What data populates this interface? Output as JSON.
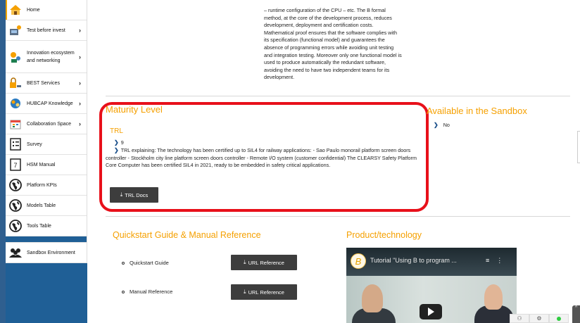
{
  "sidebar": {
    "items": [
      {
        "label": "Home",
        "icon": "house-icon",
        "chevron": false
      },
      {
        "label": "Test before invest",
        "icon": "equipment-icon",
        "chevron": true
      },
      {
        "label": "Innovation ecosystem and networking",
        "icon": "network-icon",
        "chevron": true
      },
      {
        "label": "BEST Services",
        "icon": "services-icon",
        "chevron": true
      },
      {
        "label": "HUBCAP Knowledge",
        "icon": "knowledge-icon",
        "chevron": true
      },
      {
        "label": "Collaboration Space",
        "icon": "calendar-icon",
        "chevron": true
      },
      {
        "label": "Survey",
        "icon": "survey-icon",
        "chevron": false
      },
      {
        "label": "HSM Manual",
        "icon": "manual-icon",
        "chevron": false
      },
      {
        "label": "Platform KPIs",
        "icon": "globe-icon",
        "chevron": false
      },
      {
        "label": "Models Table",
        "icon": "globe-icon",
        "chevron": false
      },
      {
        "label": "Tools Table",
        "icon": "globe-icon",
        "chevron": false
      }
    ],
    "environment": {
      "label": "Sandbox Environment",
      "icon": "group-icon"
    },
    "chevron_glyph": "›"
  },
  "description": {
    "lines": [
      "– runtime configuration of the CPU – etc. The B formal",
      "method, at the core of the development process, reduces",
      "development, deployment and certification costs.",
      "Mathematical proof ensures that the software complies with",
      "its specification (functional model) and guarantees the",
      "absence of programming errors while avoiding unit testing",
      "and integration testing. Moreover only one functional model is",
      "used to produce automatically the redundant software,",
      "avoiding the need to have two independent teams for its",
      "development."
    ]
  },
  "maturity": {
    "title": "Maturity Level",
    "trl_label": "TRL",
    "trl_value": "9",
    "trl_explaining": "TRL explaining: The technology has been certified up to SIL4 for railway applications: - Sao Paulo monorail platform screen doors controller - Stockholm city line platform screen doors controller - Remote I/O system (customer confidential) The CLEARSY Safety Platform Core Computer has been certified SIL4 in 2021, ready to be embedded in safety critical applications.",
    "docs_button": "TRL Docs"
  },
  "sandbox": {
    "title": "Available in the Sandbox",
    "value": "No"
  },
  "quickstart": {
    "title": "Quickstart Guide & Manual Reference",
    "rows": [
      {
        "label": "Quickstart Guide",
        "button": "URL Reference"
      },
      {
        "label": "Manual Reference",
        "button": "URL Reference"
      }
    ]
  },
  "product": {
    "title": "Product/technology",
    "video_title": "Tutorial \"Using B to program ...",
    "video_logo": "B"
  },
  "glyphs": {
    "chevron_right": "›",
    "blue_chevron": "❯",
    "download": "⤓",
    "menu": "≡",
    "kebab": "⋮",
    "user": "⚇",
    "settings": "⚙",
    "up": "^"
  },
  "colors": {
    "accent_orange": "#f5a000",
    "highlight_red": "#e8101a",
    "sidebar_blue": "#1f5f96",
    "button_dark": "#3d3d3d",
    "link_blue": "#1a4f8a"
  }
}
